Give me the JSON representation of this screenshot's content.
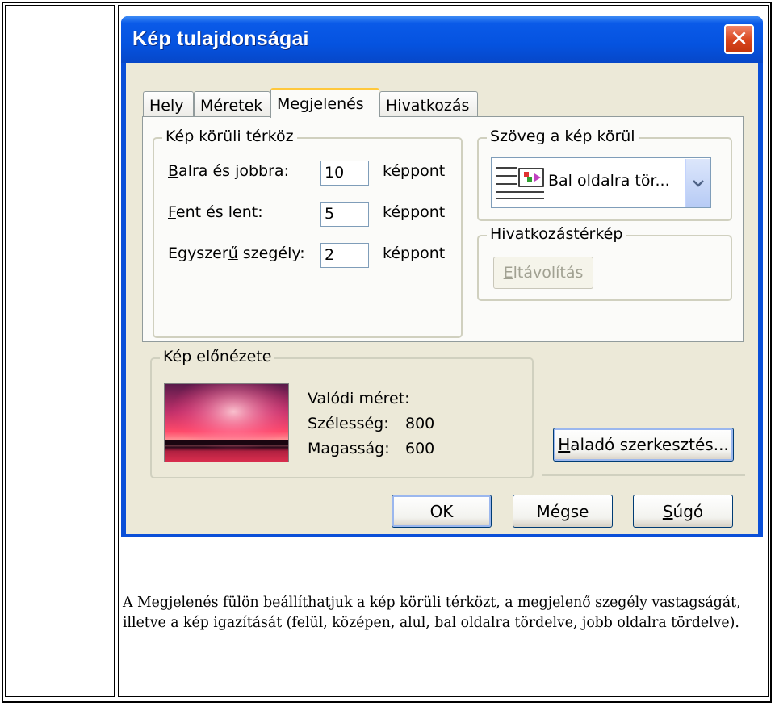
{
  "dialog": {
    "title": "Kép tulajdonságai",
    "close_symbol": "✕"
  },
  "tabs": [
    {
      "label": "Hely"
    },
    {
      "label": "Méretek"
    },
    {
      "label": "Megjelenés",
      "active": true
    },
    {
      "label": "Hivatkozás"
    }
  ],
  "spacing_group": {
    "title": "Kép körüli térköz",
    "rows": [
      {
        "label": "Balra és jobbra:",
        "value": "10",
        "unit": "képpont"
      },
      {
        "label": "Fent és lent:",
        "value": "5",
        "unit": "képpont"
      },
      {
        "label": "Egyszerű szegély:",
        "value": "2",
        "unit": "képpont"
      }
    ]
  },
  "text_wrap_group": {
    "title": "Szöveg a kép körül",
    "selected": "Bal oldalra tör..."
  },
  "imagemap_group": {
    "title": "Hivatkozástérkép",
    "remove_button": "Eltávolítás"
  },
  "preview_group": {
    "title": "Kép előnézete",
    "actual_size_label": "Valódi méret:",
    "width_label": "Szélesség:",
    "width_value": "800",
    "height_label": "Magasság:",
    "height_value": "600"
  },
  "advanced_button": "Haladó szerkesztés...",
  "buttons": {
    "ok": "OK",
    "cancel": "Mégse",
    "help": "Súgó"
  },
  "caption": "A Megjelenés fülön beállíthatjuk a kép körüli térközt, a megjelenő szegély vastagságát, illetve a kép igazítását (felül, középen, alul, bal oldalra tördelve, jobb oldalra tördelve).",
  "colors": {
    "titlebar": "#0553e0",
    "dialog_bg": "#ece9d8",
    "close_button": "#d8441c",
    "active_tab_accent": "#ffc83c"
  }
}
